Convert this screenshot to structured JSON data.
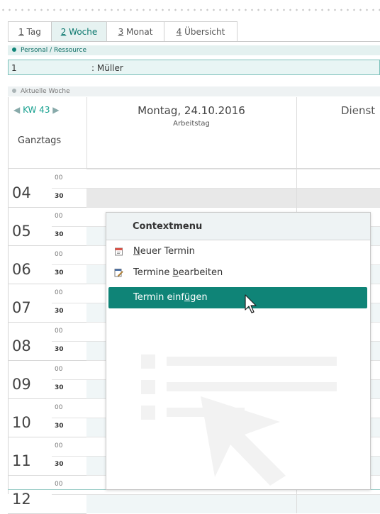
{
  "tabs": [
    {
      "key": "1",
      "label": " Tag",
      "active": false
    },
    {
      "key": "2",
      "label": " Woche",
      "active": true
    },
    {
      "key": "3",
      "label": " Monat",
      "active": false
    },
    {
      "key": "4",
      "label": " Übersicht",
      "active": false
    }
  ],
  "personal": {
    "section_label": "Personal / Ressource",
    "value_id": "1",
    "value_name": ": Müller"
  },
  "week": {
    "section_label": "Aktuelle Woche",
    "kw_label": "KW 43",
    "allday_label": "Ganztags"
  },
  "days": [
    {
      "title": "Montag, 24.10.2016",
      "subtitle": "Arbeitstag"
    },
    {
      "title": "Dienst",
      "subtitle": ""
    }
  ],
  "hours": [
    {
      "hour": "04",
      "m00": "00",
      "m30": "30"
    },
    {
      "hour": "05",
      "m00": "00",
      "m30": "30"
    },
    {
      "hour": "06",
      "m00": "00",
      "m30": "30"
    },
    {
      "hour": "07",
      "m00": "00",
      "m30": "30"
    },
    {
      "hour": "08",
      "m00": "00",
      "m30": "30"
    },
    {
      "hour": "09",
      "m00": "00",
      "m30": "30"
    },
    {
      "hour": "10",
      "m00": "00",
      "m30": "30"
    },
    {
      "hour": "11",
      "m00": "00",
      "m30": "30"
    },
    {
      "hour": "12",
      "m00": "00",
      "m30": ""
    }
  ],
  "context_menu": {
    "title": "Contextmenu",
    "items": [
      {
        "pre": "",
        "acc": "N",
        "post": "euer Termin"
      },
      {
        "pre": "Termine ",
        "acc": "b",
        "post": "earbeiten"
      },
      {
        "pre": "Termin einf",
        "acc": "ü",
        "post": "gen"
      }
    ]
  },
  "colors": {
    "accent": "#0f8477",
    "section_bg": "#e4f1f0",
    "slot_bg": "#f0f6f7"
  }
}
